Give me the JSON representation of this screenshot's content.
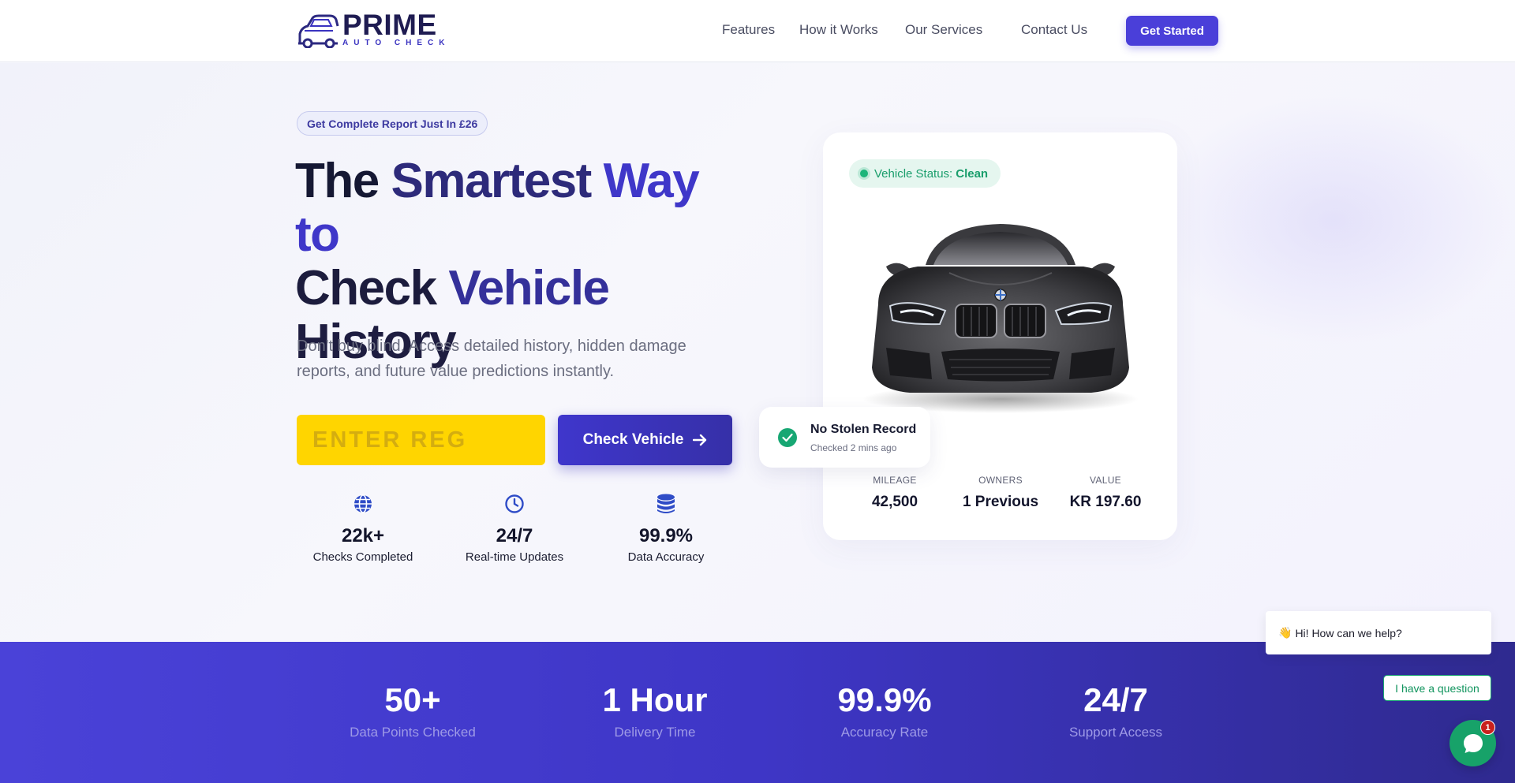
{
  "header": {
    "logo_main": "PRIME",
    "logo_sub": "AUTO CHECK",
    "nav": [
      "Features",
      "How it Works",
      "Our Services",
      "Contact Us"
    ],
    "cta": "Get Started"
  },
  "hero": {
    "badge": "Get Complete Report Just In £26",
    "title_line1_a": "The",
    "title_line1_b": "Smartest",
    "title_line1_c": "Way to",
    "title_line2_a": "Check",
    "title_line2_b": "Vehicle",
    "title_line3": "History",
    "lead": "Don't buy blind. Access detailed history, hidden damage reports, and future value predictions instantly.",
    "reg_placeholder": "ENTER REG",
    "check_button": "Check Vehicle",
    "stats": [
      {
        "icon": "globe-icon",
        "value": "22k+",
        "label": "Checks Completed"
      },
      {
        "icon": "clock-icon",
        "value": "24/7",
        "label": "Real-time Updates"
      },
      {
        "icon": "database-icon",
        "value": "99.9%",
        "label": "Data Accuracy"
      }
    ]
  },
  "card": {
    "status_label": "Vehicle Status:",
    "status_value": "Clean",
    "stolen_title": "No Stolen Record",
    "stolen_sub": "Checked 2 mins ago",
    "metrics": [
      {
        "label": "MILEAGE",
        "value": "42,500"
      },
      {
        "label": "OWNERS",
        "value": "1 Previous"
      },
      {
        "label": "VALUE",
        "value": "KR 197.60"
      }
    ]
  },
  "band": {
    "stats": [
      {
        "value": "50+",
        "label": "Data Points Checked"
      },
      {
        "value": "1 Hour",
        "label": "Delivery Time"
      },
      {
        "value": "99.9%",
        "label": "Accuracy Rate"
      },
      {
        "value": "24/7",
        "label": "Support Access"
      }
    ]
  },
  "chat": {
    "greeting": "Hi! How can we help?",
    "wave": "👋",
    "question_button": "I have a question",
    "badge_count": "1"
  },
  "colors": {
    "primary": "#4a3fd9",
    "reg_yellow": "#ffd500",
    "success": "#17a773",
    "chat_green": "#17a269"
  }
}
